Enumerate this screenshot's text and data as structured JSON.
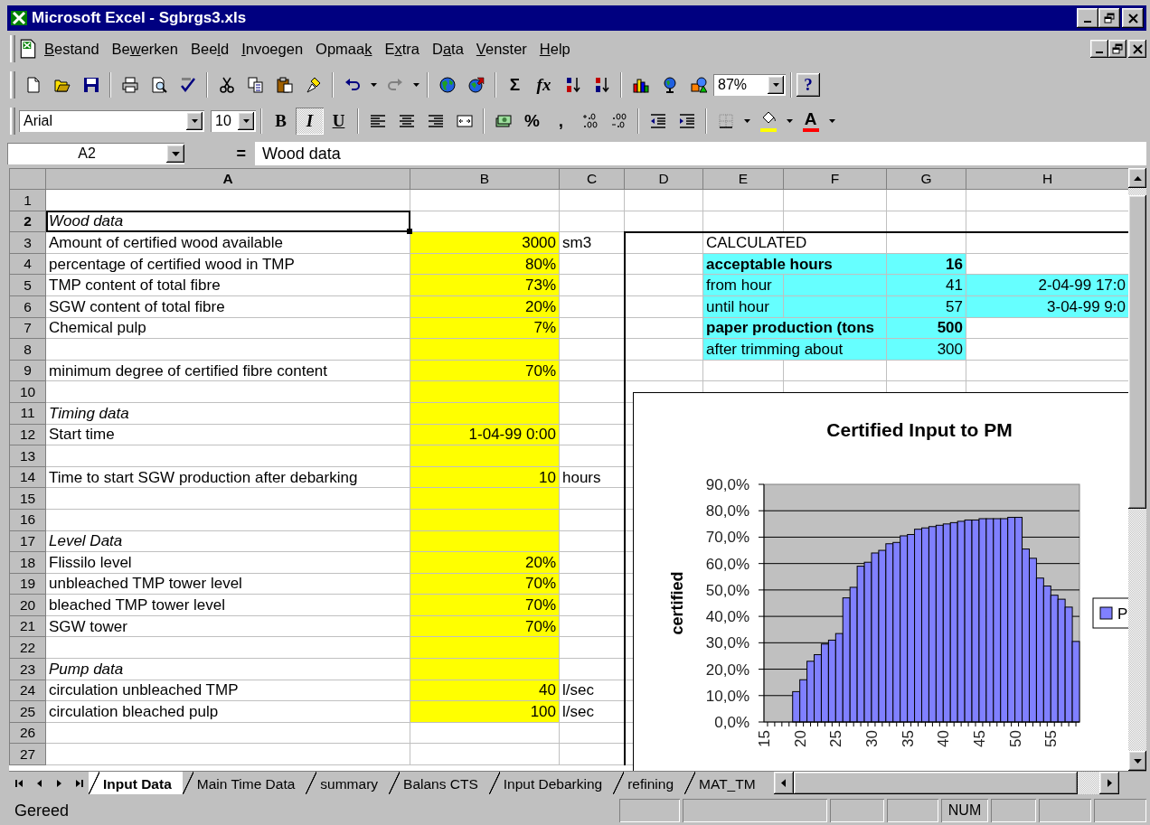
{
  "window": {
    "title": "Microsoft Excel - Sgbrgs3.xls"
  },
  "menu": [
    {
      "parts": [
        {
          "text": "B",
          "key": true
        },
        {
          "text": "estand",
          "key": false
        }
      ]
    },
    {
      "parts": [
        {
          "text": "Be",
          "key": false
        },
        {
          "text": "w",
          "key": true
        },
        {
          "text": "erken",
          "key": false
        }
      ]
    },
    {
      "parts": [
        {
          "text": "Bee",
          "key": false
        },
        {
          "text": "l",
          "key": true
        },
        {
          "text": "d",
          "key": false
        }
      ]
    },
    {
      "parts": [
        {
          "text": "I",
          "key": true
        },
        {
          "text": "nvoegen",
          "key": false
        }
      ]
    },
    {
      "parts": [
        {
          "text": "Opmaa",
          "key": false
        },
        {
          "text": "k",
          "key": true
        }
      ]
    },
    {
      "parts": [
        {
          "text": "E",
          "key": false
        },
        {
          "text": "x",
          "key": true
        },
        {
          "text": "tra",
          "key": false
        }
      ]
    },
    {
      "parts": [
        {
          "text": "D",
          "key": false
        },
        {
          "text": "a",
          "key": true
        },
        {
          "text": "ta",
          "key": false
        }
      ]
    },
    {
      "parts": [
        {
          "text": "V",
          "key": true
        },
        {
          "text": "enster",
          "key": false
        }
      ]
    },
    {
      "parts": [
        {
          "text": "H",
          "key": true
        },
        {
          "text": "elp",
          "key": false
        }
      ]
    }
  ],
  "standard_toolbar": [
    {
      "kind": "icon"
    },
    {
      "kind": "icon"
    },
    {
      "kind": "icon"
    },
    {
      "kind": "separator"
    },
    {
      "kind": "icon"
    },
    {
      "kind": "icon"
    },
    {
      "kind": "icon"
    },
    {
      "kind": "separator"
    },
    {
      "kind": "icon"
    },
    {
      "kind": "icon"
    },
    {
      "kind": "icon"
    },
    {
      "kind": "icon"
    },
    {
      "kind": "separator"
    },
    {
      "kind": "icon",
      "disabled": false,
      "dropdown": true
    },
    {
      "kind": "icon",
      "disabled": true,
      "dropdown": true
    },
    {
      "kind": "separator"
    },
    {
      "kind": "icon"
    },
    {
      "kind": "icon"
    },
    {
      "kind": "separator"
    },
    {
      "kind": "glyph",
      "text": "Σ"
    },
    {
      "kind": "glyph",
      "text": "fx"
    },
    {
      "kind": "icon"
    },
    {
      "kind": "icon"
    },
    {
      "kind": "separator"
    },
    {
      "kind": "icon"
    },
    {
      "kind": "icon"
    },
    {
      "kind": "icon"
    },
    {
      "kind": "combo",
      "value": "87%"
    },
    {
      "kind": "separator"
    },
    {
      "kind": "glyph",
      "text": "?"
    }
  ],
  "formatting_toolbar": [
    {
      "kind": "combo",
      "value": "Arial"
    },
    {
      "kind": "combo",
      "value": "10"
    },
    {
      "kind": "separator"
    },
    {
      "kind": "glyph",
      "text": "B",
      "selected": false
    },
    {
      "kind": "glyph",
      "text": "I",
      "selected": true
    },
    {
      "kind": "glyph",
      "text": "U",
      "selected": false
    },
    {
      "kind": "separator"
    },
    {
      "kind": "icon"
    },
    {
      "kind": "icon"
    },
    {
      "kind": "icon"
    },
    {
      "kind": "icon"
    },
    {
      "kind": "separator"
    },
    {
      "kind": "icon"
    },
    {
      "kind": "glyph",
      "text": "%"
    },
    {
      "kind": "glyph",
      "text": ","
    },
    {
      "kind": "icon"
    },
    {
      "kind": "icon"
    },
    {
      "kind": "separator"
    },
    {
      "kind": "icon"
    },
    {
      "kind": "icon"
    },
    {
      "kind": "separator"
    },
    {
      "kind": "icon",
      "dropdown": true
    },
    {
      "kind": "icon",
      "color": "#ffff00",
      "dropdown": true
    },
    {
      "kind": "glyph",
      "text": "A",
      "color": "#ff0000",
      "dropdown": true
    }
  ],
  "formula_bar": {
    "name_box": "A2",
    "equals": "=",
    "formula": "Wood data"
  },
  "sheet": {
    "columns": [
      {
        "label": "A",
        "selected": true
      },
      {
        "label": "B",
        "selected": false
      },
      {
        "label": "C",
        "selected": false
      },
      {
        "label": "D",
        "selected": false
      },
      {
        "label": "E",
        "selected": false
      },
      {
        "label": "F",
        "selected": false
      },
      {
        "label": "G",
        "selected": false
      },
      {
        "label": "H",
        "selected": false
      }
    ],
    "rows": [
      {
        "number": "1",
        "selected": false,
        "cells": [
          {
            "selected": false
          },
          {
            "selected": false
          },
          {
            "selected": false
          },
          {
            "selected": false
          },
          {
            "selected": false
          },
          {
            "selected": false
          },
          {
            "selected": false
          },
          {
            "selected": false
          }
        ]
      },
      {
        "number": "2",
        "selected": true,
        "cells": [
          {
            "text": "Wood data",
            "kind": "heading",
            "selected": true
          },
          {
            "selected": false
          },
          {
            "selected": false
          },
          {
            "selected": false
          },
          {
            "selected": false
          },
          {
            "selected": false
          },
          {
            "selected": false
          },
          {
            "selected": false
          }
        ]
      },
      {
        "number": "3",
        "selected": false,
        "cells": [
          {
            "text": "Amount of certified wood available",
            "selected": false
          },
          {
            "text": "3000",
            "kind": "number",
            "color": "#ffff00",
            "selected": false
          },
          {
            "text": "sm3",
            "selected": false
          },
          {
            "selected": false
          },
          {
            "text": "CALCULATED",
            "colspan": 2,
            "selected": false
          },
          {
            "selected": false
          },
          {
            "selected": false
          }
        ]
      },
      {
        "number": "4",
        "selected": false,
        "cells": [
          {
            "text": "percentage of certified wood in TMP",
            "selected": false
          },
          {
            "text": "80%",
            "kind": "number",
            "color": "#ffff00",
            "selected": false
          },
          {
            "selected": false
          },
          {
            "selected": false
          },
          {
            "text": "acceptable hours",
            "kind": "caption",
            "color": "#66ffff",
            "colspan": 2,
            "selected": false
          },
          {
            "text": "16",
            "kind": "total",
            "color": "#66ffff",
            "selected": false
          },
          {
            "selected": false
          }
        ]
      },
      {
        "number": "5",
        "selected": false,
        "cells": [
          {
            "text": "TMP content of total fibre",
            "selected": false
          },
          {
            "text": "73%",
            "kind": "number",
            "color": "#ffff00",
            "selected": false
          },
          {
            "selected": false
          },
          {
            "selected": false
          },
          {
            "text": "from hour",
            "color": "#66ffff",
            "selected": false
          },
          {
            "color": "#66ffff",
            "selected": false
          },
          {
            "text": "41",
            "kind": "number",
            "color": "#66ffff",
            "selected": false
          },
          {
            "text": "2-04-99 17:0",
            "kind": "number",
            "color": "#66ffff",
            "selected": false
          }
        ]
      },
      {
        "number": "6",
        "selected": false,
        "cells": [
          {
            "text": "SGW content of total fibre",
            "selected": false
          },
          {
            "text": "20%",
            "kind": "number",
            "color": "#ffff00",
            "selected": false
          },
          {
            "selected": false
          },
          {
            "selected": false
          },
          {
            "text": "until hour",
            "color": "#66ffff",
            "selected": false
          },
          {
            "color": "#66ffff",
            "selected": false
          },
          {
            "text": "57",
            "kind": "number",
            "color": "#66ffff",
            "selected": false
          },
          {
            "text": "3-04-99 9:0",
            "kind": "number",
            "color": "#66ffff",
            "selected": false
          }
        ]
      },
      {
        "number": "7",
        "selected": false,
        "cells": [
          {
            "text": "Chemical pulp",
            "selected": false
          },
          {
            "text": "7%",
            "kind": "number",
            "color": "#ffff00",
            "selected": false
          },
          {
            "selected": false
          },
          {
            "selected": false
          },
          {
            "text": "paper production (tons",
            "kind": "caption",
            "color": "#66ffff",
            "colspan": 2,
            "selected": false
          },
          {
            "text": "500",
            "kind": "total",
            "color": "#66ffff",
            "selected": false
          },
          {
            "selected": false
          }
        ]
      },
      {
        "number": "8",
        "selected": false,
        "cells": [
          {
            "selected": false
          },
          {
            "color": "#ffff00",
            "selected": false
          },
          {
            "selected": false
          },
          {
            "selected": false
          },
          {
            "text": "after trimming about",
            "color": "#66ffff",
            "colspan": 2,
            "selected": false
          },
          {
            "text": "300",
            "kind": "number",
            "color": "#66ffff",
            "selected": false
          },
          {
            "selected": false
          }
        ]
      },
      {
        "number": "9",
        "selected": false,
        "cells": [
          {
            "text": "minimum degree of certified fibre content",
            "selected": false
          },
          {
            "text": "70%",
            "kind": "number",
            "color": "#ffff00",
            "selected": false
          },
          {
            "selected": false
          },
          {
            "selected": false
          },
          {
            "selected": false
          },
          {
            "selected": false
          },
          {
            "selected": false
          },
          {
            "selected": false
          }
        ]
      },
      {
        "number": "10",
        "selected": false,
        "cells": [
          {
            "selected": false
          },
          {
            "color": "#ffff00",
            "selected": false
          },
          {
            "selected": false
          }
        ]
      },
      {
        "number": "11",
        "selected": false,
        "cells": [
          {
            "text": "Timing data",
            "kind": "heading",
            "selected": false
          },
          {
            "color": "#ffff00",
            "selected": false
          },
          {
            "selected": false
          }
        ]
      },
      {
        "number": "12",
        "selected": false,
        "cells": [
          {
            "text": "Start time",
            "selected": false
          },
          {
            "text": "1-04-99 0:00",
            "kind": "number",
            "color": "#ffff00",
            "selected": false
          },
          {
            "selected": false
          }
        ]
      },
      {
        "number": "13",
        "selected": false,
        "cells": [
          {
            "selected": false
          },
          {
            "color": "#ffff00",
            "selected": false
          },
          {
            "selected": false
          }
        ]
      },
      {
        "number": "14",
        "selected": false,
        "cells": [
          {
            "text": "Time to start SGW production after debarking",
            "selected": false
          },
          {
            "text": "10",
            "kind": "number",
            "color": "#ffff00",
            "selected": false
          },
          {
            "text": "hours",
            "selected": false
          }
        ]
      },
      {
        "number": "15",
        "selected": false,
        "cells": [
          {
            "selected": false
          },
          {
            "color": "#ffff00",
            "selected": false
          },
          {
            "selected": false
          }
        ]
      },
      {
        "number": "16",
        "selected": false,
        "cells": [
          {
            "selected": false
          },
          {
            "color": "#ffff00",
            "selected": false
          },
          {
            "selected": false
          }
        ]
      },
      {
        "number": "17",
        "selected": false,
        "cells": [
          {
            "text": "Level Data",
            "kind": "heading",
            "selected": false
          },
          {
            "color": "#ffff00",
            "selected": false
          },
          {
            "selected": false
          }
        ]
      },
      {
        "number": "18",
        "selected": false,
        "cells": [
          {
            "text": "Flissilo level",
            "selected": false
          },
          {
            "text": "20%",
            "kind": "number",
            "color": "#ffff00",
            "selected": false
          },
          {
            "selected": false
          }
        ]
      },
      {
        "number": "19",
        "selected": false,
        "cells": [
          {
            "text": "unbleached TMP tower level",
            "selected": false
          },
          {
            "text": "70%",
            "kind": "number",
            "color": "#ffff00",
            "selected": false
          },
          {
            "selected": false
          }
        ]
      },
      {
        "number": "20",
        "selected": false,
        "cells": [
          {
            "text": "bleached TMP tower level",
            "selected": false
          },
          {
            "text": "70%",
            "kind": "number",
            "color": "#ffff00",
            "selected": false
          },
          {
            "selected": false
          }
        ]
      },
      {
        "number": "21",
        "selected": false,
        "cells": [
          {
            "text": "SGW tower",
            "selected": false
          },
          {
            "text": "70%",
            "kind": "number",
            "color": "#ffff00",
            "selected": false
          },
          {
            "selected": false
          }
        ]
      },
      {
        "number": "22",
        "selected": false,
        "cells": [
          {
            "selected": false
          },
          {
            "color": "#ffff00",
            "selected": false
          },
          {
            "selected": false
          }
        ]
      },
      {
        "number": "23",
        "selected": false,
        "cells": [
          {
            "text": "Pump data",
            "kind": "heading",
            "selected": false
          },
          {
            "color": "#ffff00",
            "selected": false
          },
          {
            "selected": false
          }
        ]
      },
      {
        "number": "24",
        "selected": false,
        "cells": [
          {
            "text": "circulation unbleached TMP",
            "selected": false
          },
          {
            "text": "40",
            "kind": "number",
            "color": "#ffff00",
            "selected": false
          },
          {
            "text": "l/sec",
            "selected": false
          }
        ]
      },
      {
        "number": "25",
        "selected": false,
        "cells": [
          {
            "text": "circulation bleached pulp",
            "selected": false
          },
          {
            "text": "100",
            "kind": "number",
            "color": "#ffff00",
            "selected": false
          },
          {
            "text": "l/sec",
            "selected": false
          }
        ]
      },
      {
        "number": "26",
        "selected": false,
        "cells": [
          {
            "selected": false
          },
          {
            "selected": false
          },
          {
            "selected": false
          }
        ]
      },
      {
        "number": "27",
        "selected": false,
        "cells": [
          {
            "selected": false
          },
          {
            "selected": false
          },
          {
            "selected": false
          }
        ]
      }
    ],
    "chart": {
      "chart_data": {
        "type": "bar",
        "title": "Certified Input to PM",
        "ylabel": "certified",
        "x": [
          15,
          16,
          17,
          18,
          19,
          20,
          21,
          22,
          23,
          24,
          25,
          26,
          27,
          28,
          29,
          30,
          31,
          32,
          33,
          34,
          35,
          36,
          37,
          38,
          39,
          40,
          41,
          42,
          43,
          44,
          45,
          46,
          47,
          48,
          49,
          50,
          51,
          52,
          53,
          54,
          55,
          56,
          57,
          58
        ],
        "series": [
          {
            "name": "P",
            "color": "#8080ff",
            "values": [
              0,
              0,
              0,
              0,
              11.5,
              16,
              23,
              25.5,
              29.5,
              31,
              33.5,
              47,
              51,
              59,
              60.5,
              64,
              65,
              67.5,
              68,
              70.5,
              71,
              73,
              73.5,
              74,
              74.5,
              75,
              75.5,
              76,
              76.5,
              76.5,
              77,
              77,
              77,
              77,
              77.5,
              77.5,
              65.5,
              62,
              54.5,
              51.5,
              48,
              46.5,
              43.5,
              30.5
            ]
          }
        ],
        "xlim": [
          14.5,
          58.5
        ],
        "ylim": [
          0,
          90
        ],
        "grid": true,
        "yticks": [
          {
            "value": 0,
            "label": "0,0%"
          },
          {
            "value": 10,
            "label": "10,0%"
          },
          {
            "value": 20,
            "label": "20,0%"
          },
          {
            "value": 30,
            "label": "30,0%"
          },
          {
            "value": 40,
            "label": "40,0%"
          },
          {
            "value": 50,
            "label": "50,0%"
          },
          {
            "value": 60,
            "label": "60,0%"
          },
          {
            "value": 70,
            "label": "70,0%"
          },
          {
            "value": 80,
            "label": "80,0%"
          },
          {
            "value": 90,
            "label": "90,0%"
          }
        ],
        "xticks": [
          15,
          20,
          25,
          30,
          35,
          40,
          45,
          50,
          55
        ]
      }
    }
  },
  "sheet_tabs": [
    {
      "label": "Input Data",
      "selected": true
    },
    {
      "label": "Main Time Data",
      "selected": false
    },
    {
      "label": "summary",
      "selected": false
    },
    {
      "label": "Balans CTS",
      "selected": false
    },
    {
      "label": "Input Debarking",
      "selected": false
    },
    {
      "label": "refining",
      "selected": false
    },
    {
      "label": "MAT_TM",
      "selected": false
    }
  ],
  "status_bar": {
    "text": "Gereed",
    "indicators": [
      "NUM"
    ]
  }
}
